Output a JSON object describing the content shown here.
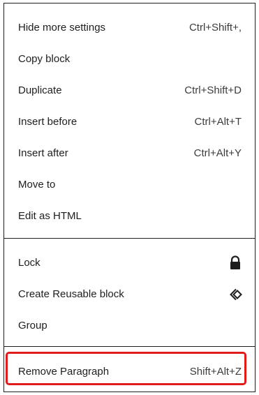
{
  "menu": {
    "group1": [
      {
        "label": "Hide more settings",
        "shortcut": "Ctrl+Shift+,"
      },
      {
        "label": "Copy block",
        "shortcut": ""
      },
      {
        "label": "Duplicate",
        "shortcut": "Ctrl+Shift+D"
      },
      {
        "label": "Insert before",
        "shortcut": "Ctrl+Alt+T"
      },
      {
        "label": "Insert after",
        "shortcut": "Ctrl+Alt+Y"
      },
      {
        "label": "Move to",
        "shortcut": ""
      },
      {
        "label": "Edit as HTML",
        "shortcut": ""
      }
    ],
    "group2": [
      {
        "label": "Lock",
        "icon": "lock-icon"
      },
      {
        "label": "Create Reusable block",
        "icon": "reusable-block-icon"
      },
      {
        "label": "Group",
        "icon": ""
      }
    ],
    "group3": [
      {
        "label": "Remove Paragraph",
        "shortcut": "Shift+Alt+Z"
      }
    ]
  },
  "colors": {
    "text": "#1e1e1e",
    "border": "#1e1e1e",
    "highlight": "#e01b1b"
  }
}
